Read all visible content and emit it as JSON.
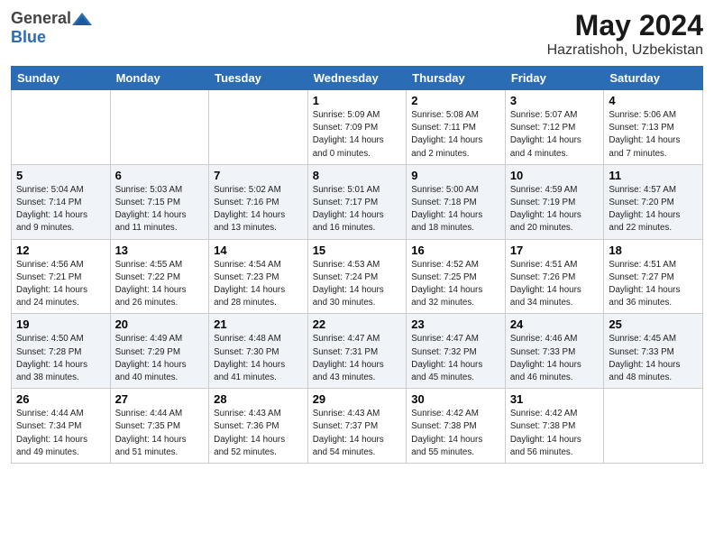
{
  "header": {
    "logo_general": "General",
    "logo_blue": "Blue",
    "title": "May 2024",
    "location": "Hazratishoh, Uzbekistan"
  },
  "weekdays": [
    "Sunday",
    "Monday",
    "Tuesday",
    "Wednesday",
    "Thursday",
    "Friday",
    "Saturday"
  ],
  "weeks": [
    [
      {
        "day": "",
        "info": ""
      },
      {
        "day": "",
        "info": ""
      },
      {
        "day": "",
        "info": ""
      },
      {
        "day": "1",
        "info": "Sunrise: 5:09 AM\nSunset: 7:09 PM\nDaylight: 14 hours\nand 0 minutes."
      },
      {
        "day": "2",
        "info": "Sunrise: 5:08 AM\nSunset: 7:11 PM\nDaylight: 14 hours\nand 2 minutes."
      },
      {
        "day": "3",
        "info": "Sunrise: 5:07 AM\nSunset: 7:12 PM\nDaylight: 14 hours\nand 4 minutes."
      },
      {
        "day": "4",
        "info": "Sunrise: 5:06 AM\nSunset: 7:13 PM\nDaylight: 14 hours\nand 7 minutes."
      }
    ],
    [
      {
        "day": "5",
        "info": "Sunrise: 5:04 AM\nSunset: 7:14 PM\nDaylight: 14 hours\nand 9 minutes."
      },
      {
        "day": "6",
        "info": "Sunrise: 5:03 AM\nSunset: 7:15 PM\nDaylight: 14 hours\nand 11 minutes."
      },
      {
        "day": "7",
        "info": "Sunrise: 5:02 AM\nSunset: 7:16 PM\nDaylight: 14 hours\nand 13 minutes."
      },
      {
        "day": "8",
        "info": "Sunrise: 5:01 AM\nSunset: 7:17 PM\nDaylight: 14 hours\nand 16 minutes."
      },
      {
        "day": "9",
        "info": "Sunrise: 5:00 AM\nSunset: 7:18 PM\nDaylight: 14 hours\nand 18 minutes."
      },
      {
        "day": "10",
        "info": "Sunrise: 4:59 AM\nSunset: 7:19 PM\nDaylight: 14 hours\nand 20 minutes."
      },
      {
        "day": "11",
        "info": "Sunrise: 4:57 AM\nSunset: 7:20 PM\nDaylight: 14 hours\nand 22 minutes."
      }
    ],
    [
      {
        "day": "12",
        "info": "Sunrise: 4:56 AM\nSunset: 7:21 PM\nDaylight: 14 hours\nand 24 minutes."
      },
      {
        "day": "13",
        "info": "Sunrise: 4:55 AM\nSunset: 7:22 PM\nDaylight: 14 hours\nand 26 minutes."
      },
      {
        "day": "14",
        "info": "Sunrise: 4:54 AM\nSunset: 7:23 PM\nDaylight: 14 hours\nand 28 minutes."
      },
      {
        "day": "15",
        "info": "Sunrise: 4:53 AM\nSunset: 7:24 PM\nDaylight: 14 hours\nand 30 minutes."
      },
      {
        "day": "16",
        "info": "Sunrise: 4:52 AM\nSunset: 7:25 PM\nDaylight: 14 hours\nand 32 minutes."
      },
      {
        "day": "17",
        "info": "Sunrise: 4:51 AM\nSunset: 7:26 PM\nDaylight: 14 hours\nand 34 minutes."
      },
      {
        "day": "18",
        "info": "Sunrise: 4:51 AM\nSunset: 7:27 PM\nDaylight: 14 hours\nand 36 minutes."
      }
    ],
    [
      {
        "day": "19",
        "info": "Sunrise: 4:50 AM\nSunset: 7:28 PM\nDaylight: 14 hours\nand 38 minutes."
      },
      {
        "day": "20",
        "info": "Sunrise: 4:49 AM\nSunset: 7:29 PM\nDaylight: 14 hours\nand 40 minutes."
      },
      {
        "day": "21",
        "info": "Sunrise: 4:48 AM\nSunset: 7:30 PM\nDaylight: 14 hours\nand 41 minutes."
      },
      {
        "day": "22",
        "info": "Sunrise: 4:47 AM\nSunset: 7:31 PM\nDaylight: 14 hours\nand 43 minutes."
      },
      {
        "day": "23",
        "info": "Sunrise: 4:47 AM\nSunset: 7:32 PM\nDaylight: 14 hours\nand 45 minutes."
      },
      {
        "day": "24",
        "info": "Sunrise: 4:46 AM\nSunset: 7:33 PM\nDaylight: 14 hours\nand 46 minutes."
      },
      {
        "day": "25",
        "info": "Sunrise: 4:45 AM\nSunset: 7:33 PM\nDaylight: 14 hours\nand 48 minutes."
      }
    ],
    [
      {
        "day": "26",
        "info": "Sunrise: 4:44 AM\nSunset: 7:34 PM\nDaylight: 14 hours\nand 49 minutes."
      },
      {
        "day": "27",
        "info": "Sunrise: 4:44 AM\nSunset: 7:35 PM\nDaylight: 14 hours\nand 51 minutes."
      },
      {
        "day": "28",
        "info": "Sunrise: 4:43 AM\nSunset: 7:36 PM\nDaylight: 14 hours\nand 52 minutes."
      },
      {
        "day": "29",
        "info": "Sunrise: 4:43 AM\nSunset: 7:37 PM\nDaylight: 14 hours\nand 54 minutes."
      },
      {
        "day": "30",
        "info": "Sunrise: 4:42 AM\nSunset: 7:38 PM\nDaylight: 14 hours\nand 55 minutes."
      },
      {
        "day": "31",
        "info": "Sunrise: 4:42 AM\nSunset: 7:38 PM\nDaylight: 14 hours\nand 56 minutes."
      },
      {
        "day": "",
        "info": ""
      }
    ]
  ]
}
